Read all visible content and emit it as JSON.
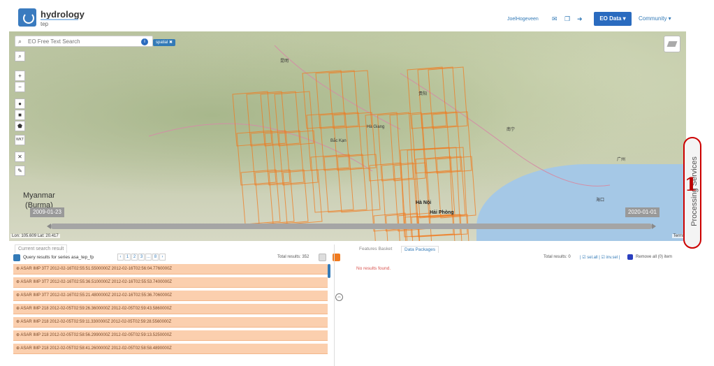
{
  "header": {
    "title": "hydrology",
    "subtitle": "tep",
    "user": "JoelHogeveen",
    "eo_data_label": "EO Data ▾",
    "community_label": "Community ▾",
    "icons": [
      "envelope-icon",
      "copy-icon",
      "signout-icon"
    ]
  },
  "map": {
    "search_placeholder": "EO Free Text Search",
    "spatial_tag": "spatial ✖",
    "country": "Myanmar\n(Burma)",
    "places": [
      "Hà Giang",
      "Bắc Kạn",
      "Hà Nội",
      "Hải Phòng"
    ],
    "chinese_labels": [
      "昆明",
      "贵阳",
      "南宁",
      "广州",
      "海口"
    ],
    "date_start": "2009-01-23",
    "date_end": "2020-01-01",
    "coords": "Lon: 105.609  Lat: 20.417",
    "terms": "Terms",
    "tools": [
      "search",
      "zoom-in",
      "zoom-out",
      "point",
      "box",
      "polygon",
      "wkt",
      "clear",
      "edit"
    ]
  },
  "side_tab": {
    "label": "Processing Services",
    "annotation": "1"
  },
  "left_panel": {
    "tab": "Current search result",
    "series_text": "Query results for series asa_tep_fp",
    "pages": [
      "‹",
      "1",
      "2",
      "3",
      "...",
      "8",
      "›"
    ],
    "total_results": "Total results: 352",
    "rows": [
      "ASAR IMP 3T7 2012-02-16T02:55:51.5500000Z 2012-02-16T02:56:04.7760000Z",
      "ASAR IMP 3T7 2012-02-16T02:55:36.5100000Z 2012-02-16T02:55:53.7400000Z",
      "ASAR IMP 3T7 2012-02-16T02:55:21.4800000Z 2012-02-16T02:55:36.7060000Z",
      "ASAR IMP 218 2012-02-05T02:59:26.3600000Z 2012-02-05T02:59:43.5860000Z",
      "ASAR IMP 218 2012-02-05T02:59:11.3300000Z 2012-02-05T02:59:28.5560000Z",
      "ASAR IMP 218 2012-02-05T02:58:56.2990000Z 2012-02-05T02:59:13.5250000Z",
      "ASAR IMP 218 2012-02-05T02:58:41.2600000Z 2012-02-05T02:58:58.4890000Z"
    ]
  },
  "right_panel": {
    "tabs": [
      "Features Basket",
      "Data Packages"
    ],
    "total_results": "Total results: 0",
    "select_all": "| ☑ sel.all | ☑ inv.sel |",
    "remove_all": "Remove all (0) item",
    "no_results": "No results found."
  },
  "colors": {
    "accent": "#2a6bbf",
    "row_bg": "#fbcfae",
    "footprint": "#f07a1e",
    "annotation": "#cc0000"
  }
}
